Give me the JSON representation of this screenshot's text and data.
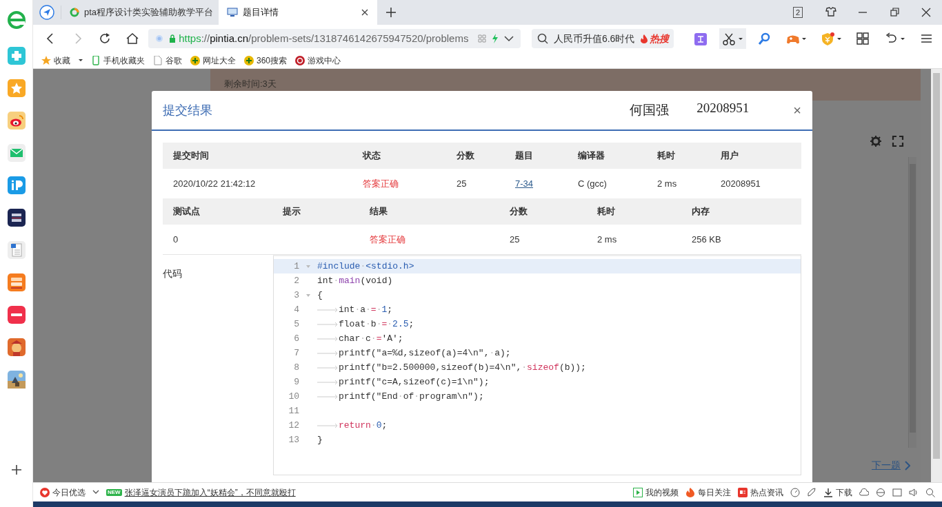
{
  "browser": {
    "tabs": [
      {
        "label": "pta程序设计类实验辅助教学平台",
        "selected": false,
        "kind": "pta"
      },
      {
        "label": "题目详情",
        "selected": true,
        "kind": "page"
      }
    ],
    "tab_count": "2",
    "address": [
      {
        "text": "https",
        "kind": "scheme"
      },
      {
        "text": "://",
        "kind": "sep"
      },
      {
        "text": "pintia.cn",
        "kind": "host"
      },
      {
        "text": "/problem-sets/1318746142675947520/problems",
        "kind": "path"
      }
    ],
    "search": {
      "text": "人民币升值6.6时代",
      "hot": "热搜"
    },
    "bookmarks": [
      {
        "label": "收藏",
        "kind": "star"
      },
      {
        "label": "手机收藏夹",
        "kind": "phone"
      },
      {
        "label": "谷歌",
        "kind": "doc"
      },
      {
        "label": "网址大全",
        "kind": "plus"
      },
      {
        "label": "360搜索",
        "kind": "plus"
      },
      {
        "label": "游戏中心",
        "kind": "game"
      }
    ]
  },
  "sidebar": {
    "apps": [
      {
        "kind": "e"
      },
      {
        "kind": "plus"
      },
      {
        "kind": "star"
      },
      {
        "kind": "weibo"
      },
      {
        "kind": "mail"
      },
      {
        "kind": "ip"
      },
      {
        "kind": "navy"
      },
      {
        "kind": "doc"
      },
      {
        "kind": "novel"
      },
      {
        "kind": "red"
      },
      {
        "kind": "game"
      },
      {
        "kind": "picture"
      }
    ]
  },
  "page": {
    "remaining": "剩余时间:3天",
    "next": "下一题"
  },
  "dialog": {
    "title": "提交结果",
    "user_name": "何国强",
    "user_id": "20208951",
    "close": "×",
    "summary": {
      "columns": [
        "提交时间",
        "状态",
        "分数",
        "题目",
        "编译器",
        "耗时",
        "用户"
      ],
      "row": [
        {
          "text": "2020/10/22 21:42:12",
          "kind": "plain"
        },
        {
          "text": "答案正确",
          "kind": "status"
        },
        {
          "text": "25",
          "kind": "plain"
        },
        {
          "text": "7-34",
          "kind": "link"
        },
        {
          "text": "C (gcc)",
          "kind": "plain"
        },
        {
          "text": "2 ms",
          "kind": "plain"
        },
        {
          "text": "20208951",
          "kind": "plain"
        }
      ]
    },
    "tests": {
      "columns": [
        "测试点",
        "提示",
        "结果",
        "分数",
        "耗时",
        "内存"
      ],
      "row": [
        {
          "text": "0",
          "kind": "plain"
        },
        {
          "text": "答案正确",
          "kind": "status"
        },
        {
          "text": "25",
          "kind": "plain"
        },
        {
          "text": "2 ms",
          "kind": "plain"
        },
        {
          "text": "256 KB",
          "kind": "plain"
        }
      ]
    },
    "code_label": "代码",
    "code": [
      {
        "number": "1",
        "fold": true,
        "active": true,
        "tab": false,
        "tokens": [
          {
            "text": "#include",
            "kind": "meta"
          },
          {
            "text": "·",
            "kind": "space"
          },
          {
            "text": "<stdio.h>",
            "kind": "meta"
          }
        ]
      },
      {
        "number": "2",
        "fold": false,
        "active": false,
        "tab": false,
        "tokens": [
          {
            "text": "int",
            "kind": "plain"
          },
          {
            "text": "·",
            "kind": "space"
          },
          {
            "text": "main",
            "kind": "function"
          },
          {
            "text": "(void)",
            "kind": "plain"
          }
        ]
      },
      {
        "number": "3",
        "fold": true,
        "active": false,
        "tab": false,
        "tokens": [
          {
            "text": "{",
            "kind": "plain"
          }
        ]
      },
      {
        "number": "4",
        "fold": false,
        "active": false,
        "tab": true,
        "tokens": [
          {
            "text": "int",
            "kind": "plain"
          },
          {
            "text": "·",
            "kind": "space"
          },
          {
            "text": "a",
            "kind": "plain"
          },
          {
            "text": "·",
            "kind": "space"
          },
          {
            "text": "=",
            "kind": "operator"
          },
          {
            "text": "·",
            "kind": "space"
          },
          {
            "text": "1",
            "kind": "number"
          },
          {
            "text": ";",
            "kind": "plain"
          }
        ]
      },
      {
        "number": "5",
        "fold": false,
        "active": false,
        "tab": true,
        "tokens": [
          {
            "text": "float",
            "kind": "plain"
          },
          {
            "text": "·",
            "kind": "space"
          },
          {
            "text": "b",
            "kind": "plain"
          },
          {
            "text": "·",
            "kind": "space"
          },
          {
            "text": "=",
            "kind": "operator"
          },
          {
            "text": "·",
            "kind": "space"
          },
          {
            "text": "2.5",
            "kind": "number"
          },
          {
            "text": ";",
            "kind": "plain"
          }
        ]
      },
      {
        "number": "6",
        "fold": false,
        "active": false,
        "tab": true,
        "tokens": [
          {
            "text": "char",
            "kind": "plain"
          },
          {
            "text": "·",
            "kind": "space"
          },
          {
            "text": "c",
            "kind": "plain"
          },
          {
            "text": "·",
            "kind": "space"
          },
          {
            "text": "=",
            "kind": "operator"
          },
          {
            "text": "'A';",
            "kind": "plain"
          }
        ]
      },
      {
        "number": "7",
        "fold": false,
        "active": false,
        "tab": true,
        "tokens": [
          {
            "text": "printf(\"a=%d,sizeof(a)=4\\n\",",
            "kind": "plain"
          },
          {
            "text": "·",
            "kind": "space"
          },
          {
            "text": "a);",
            "kind": "plain"
          }
        ]
      },
      {
        "number": "8",
        "fold": false,
        "active": false,
        "tab": true,
        "tokens": [
          {
            "text": "printf(\"b=2.500000,sizeof(b)=4\\n\",",
            "kind": "plain"
          },
          {
            "text": "·",
            "kind": "space"
          },
          {
            "text": "sizeof",
            "kind": "keyword"
          },
          {
            "text": "(b));",
            "kind": "plain"
          }
        ]
      },
      {
        "number": "9",
        "fold": false,
        "active": false,
        "tab": true,
        "tokens": [
          {
            "text": "printf(\"c=A,sizeof(c)=1\\n\");",
            "kind": "plain"
          }
        ]
      },
      {
        "number": "10",
        "fold": false,
        "active": false,
        "tab": true,
        "tokens": [
          {
            "text": "printf(\"End",
            "kind": "plain"
          },
          {
            "text": "·",
            "kind": "space"
          },
          {
            "text": "of",
            "kind": "plain"
          },
          {
            "text": "·",
            "kind": "space"
          },
          {
            "text": "program\\n\");",
            "kind": "plain"
          }
        ]
      },
      {
        "number": "11",
        "fold": false,
        "active": false,
        "tab": false
      },
      {
        "number": "12",
        "fold": false,
        "active": false,
        "tab": true,
        "tokens": [
          {
            "text": "return",
            "kind": "keyword"
          },
          {
            "text": "·",
            "kind": "space"
          },
          {
            "text": "0",
            "kind": "number"
          },
          {
            "text": ";",
            "kind": "plain"
          }
        ]
      },
      {
        "number": "13",
        "fold": false,
        "active": false,
        "tab": false,
        "tokens": [
          {
            "text": "}",
            "kind": "plain"
          }
        ]
      }
    ]
  },
  "status_bar": {
    "left": [
      {
        "text": "今日优选",
        "kind": "heart"
      }
    ],
    "badge": "NEW",
    "news": "张泽逼女演员下跪加入“妖精会”，不同意就殴打",
    "right": [
      {
        "text": "我的视频",
        "kind": "video"
      },
      {
        "text": "每日关注",
        "kind": "fire"
      },
      {
        "text": "热点资讯",
        "kind": "news"
      },
      {
        "text": "下载",
        "kind": "download"
      }
    ]
  }
}
